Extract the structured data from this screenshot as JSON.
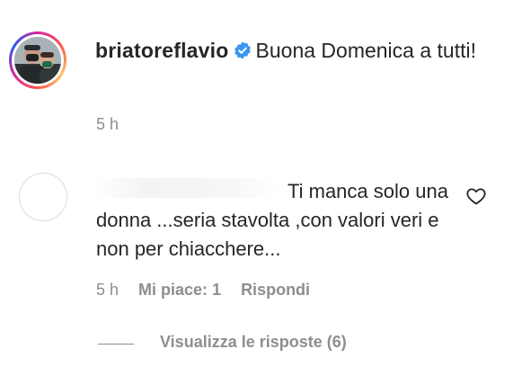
{
  "caption": {
    "username": "briatoreflavio",
    "verified_icon": "verified-badge-icon",
    "text": "Buona Domenica a tutti!",
    "time": "5 h"
  },
  "reply": {
    "text": "Ti manca solo una donna ...seria stavolta ,con valori veri e non per chiacchere...",
    "time": "5 h",
    "likes_label": "Mi piace: 1",
    "reply_label": "Rispondi",
    "like_icon": "heart-outline-icon"
  },
  "view_replies": {
    "label": "Visualizza le risposte (6)"
  },
  "colors": {
    "text": "#262626",
    "secondary": "#8e8e8e",
    "verified": "#3897f0"
  }
}
